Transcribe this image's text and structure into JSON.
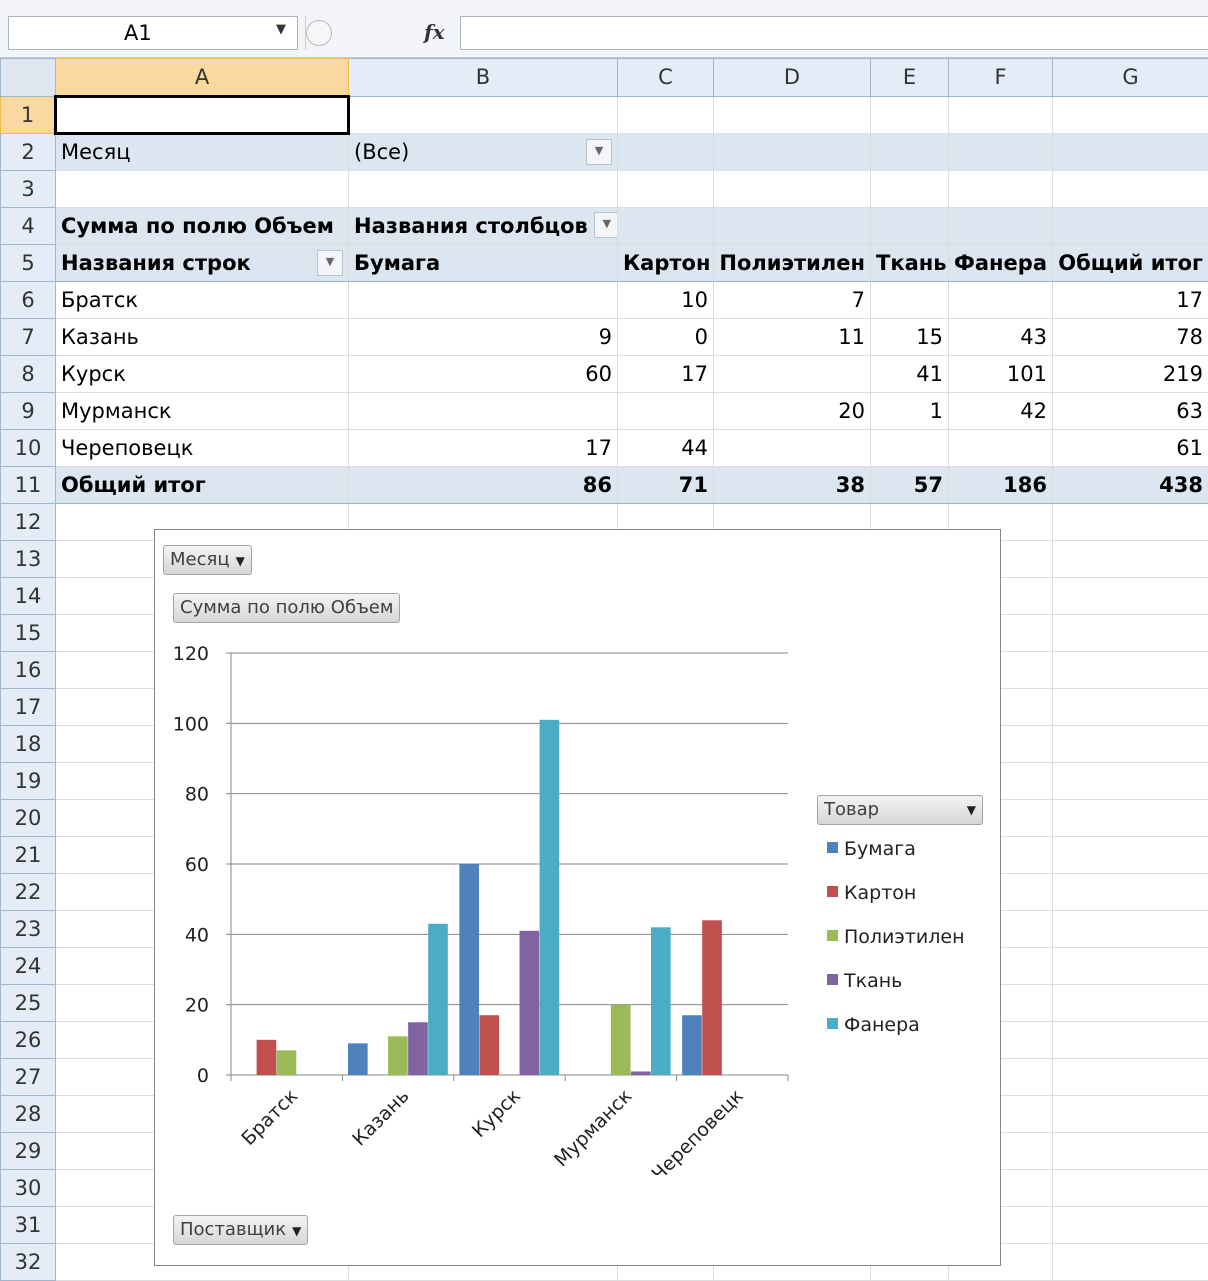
{
  "formula_bar": {
    "name_box": "A1",
    "fx_label": "fx",
    "formula_value": ""
  },
  "columns": [
    "A",
    "B",
    "C",
    "D",
    "E",
    "F",
    "G"
  ],
  "rows": [
    [
      "",
      "",
      "",
      "",
      "",
      "",
      ""
    ],
    [
      "Месяц",
      "(Все)",
      "",
      "",
      "",
      "",
      ""
    ],
    [
      "",
      "",
      "",
      "",
      "",
      "",
      ""
    ],
    [
      "Сумма по полю Объем",
      "Названия столбцов",
      "",
      "",
      "",
      "",
      ""
    ],
    [
      "Названия строк",
      "Бумага",
      "Картон",
      "Полиэтилен",
      "Ткань",
      "Фанера",
      "Общий итог"
    ],
    [
      "Братск",
      "",
      "10",
      "7",
      "",
      "",
      "17"
    ],
    [
      "Казань",
      "9",
      "0",
      "11",
      "15",
      "43",
      "78"
    ],
    [
      "Курск",
      "60",
      "17",
      "",
      "41",
      "101",
      "219"
    ],
    [
      "Мурманск",
      "",
      "",
      "20",
      "1",
      "42",
      "63"
    ],
    [
      "Череповецк",
      "17",
      "44",
      "",
      "",
      "",
      "61"
    ],
    [
      "Общий итог",
      "86",
      "71",
      "38",
      "57",
      "186",
      "438"
    ]
  ],
  "row_numbers": [
    "1",
    "2",
    "3",
    "4",
    "5",
    "6",
    "7",
    "8",
    "9",
    "10",
    "11",
    "12",
    "13",
    "14",
    "15",
    "16",
    "17",
    "18",
    "19",
    "20",
    "21",
    "22",
    "23",
    "24",
    "25",
    "26",
    "27",
    "28",
    "29",
    "30",
    "31",
    "32"
  ],
  "chart": {
    "buttons": {
      "filter": "Месяц",
      "values": "Сумма по полю Объем",
      "legend_field": "Товар",
      "axis_field": "Поставщик"
    }
  },
  "colors": {
    "Бумага": "#4f81bd",
    "Картон": "#c0504d",
    "Полиэтилен": "#9bbb59",
    "Ткань": "#8064a2",
    "Фанера": "#4bacc6"
  },
  "chart_data": {
    "type": "bar",
    "categories": [
      "Братск",
      "Казань",
      "Курск",
      "Мурманск",
      "Череповецк"
    ],
    "series": [
      {
        "name": "Бумага",
        "values": [
          null,
          9,
          60,
          null,
          17
        ]
      },
      {
        "name": "Картон",
        "values": [
          10,
          0,
          17,
          null,
          44
        ]
      },
      {
        "name": "Полиэтилен",
        "values": [
          7,
          11,
          null,
          20,
          null
        ]
      },
      {
        "name": "Ткань",
        "values": [
          null,
          15,
          41,
          1,
          null
        ]
      },
      {
        "name": "Фанера",
        "values": [
          null,
          43,
          101,
          42,
          null
        ]
      }
    ],
    "yticks": [
      "0",
      "20",
      "40",
      "60",
      "80",
      "100",
      "120"
    ],
    "ylim": [
      0,
      120
    ],
    "grid": true,
    "legend": "right"
  }
}
